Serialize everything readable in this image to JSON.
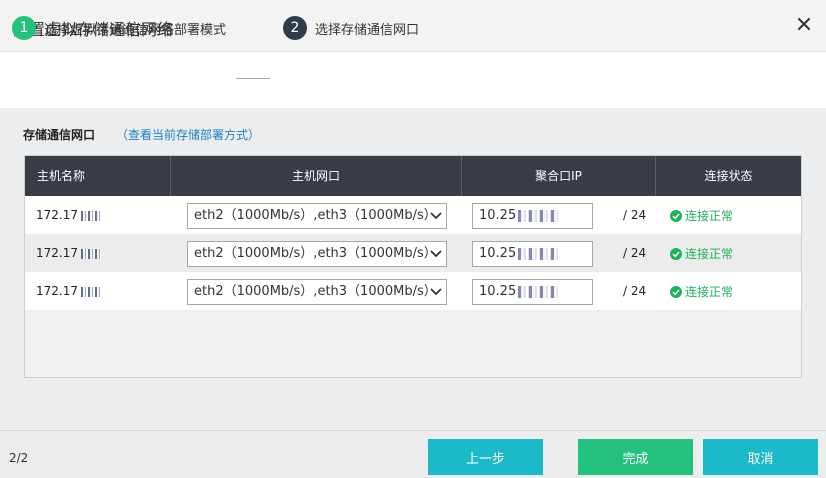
{
  "dialog": {
    "title": "配置虚拟存储通信网络"
  },
  "steps": [
    {
      "number": "1",
      "label": "选择虚拟存储通信网络部署模式"
    },
    {
      "number": "2",
      "label": "选择存储通信网口"
    }
  ],
  "section": {
    "title": "存储通信网口",
    "link": "（查看当前存储部署方式）"
  },
  "table": {
    "headers": [
      "主机名称",
      "主机网口",
      "聚合口IP",
      "连接状态"
    ],
    "rows": [
      {
        "host": "172.17",
        "ports": "eth2（1000Mb/s）,eth3（1000Mb/s）",
        "ip": "10.25",
        "mask": "/ 24",
        "status": "连接正常"
      },
      {
        "host": "172.17",
        "ports": "eth2（1000Mb/s）,eth3（1000Mb/s）",
        "ip": "10.25",
        "mask": "/ 24",
        "status": "连接正常"
      },
      {
        "host": "172.17",
        "ports": "eth2（1000Mb/s）,eth3（1000Mb/s）",
        "ip": "10.25",
        "mask": "/ 24",
        "status": "连接正常"
      }
    ]
  },
  "footer": {
    "page": "2/2",
    "prev_label": "上一步",
    "done_label": "完成",
    "cancel_label": "取消"
  },
  "colors": {
    "step_done": "#27c07c",
    "step_current": "#2f3d4a",
    "header_bg": "#373d43",
    "status_ok": "#1fb25a",
    "btn_primary": "#1cb9c8",
    "btn_done": "#24c27e"
  },
  "icons": {
    "close": "close-icon",
    "dropdown": "chevron-down-icon",
    "status": "check-circle-icon"
  }
}
